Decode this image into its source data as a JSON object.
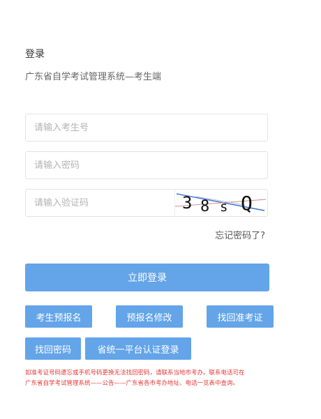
{
  "header": {
    "title": "登录",
    "subtitle": "广东省自学考试管理系统—考生端"
  },
  "form": {
    "exam_number_placeholder": "请输入考生号",
    "password_placeholder": "请输入密码",
    "captcha_placeholder": "请输入验证码",
    "captcha_text": "38sQ",
    "forgot_password": "忘记密码了?",
    "login_button": "立即登录"
  },
  "actions": {
    "pre_register": "考生预报名",
    "modify_pre_register": "预报名修改",
    "retrieve_admission_number": "找回准考证",
    "retrieve_password": "找回密码",
    "unified_platform_login": "省统一平台认证登录"
  },
  "notice": {
    "line1": "如准考证号码遗忘或手机号码更换无法找回密码，请联系当地市考办。联系电话可在",
    "line2": "广东省自学考试管理系统——公告——广东省各市考办地址、电话一览表中查询。"
  },
  "colors": {
    "primary": "#64a4e8",
    "notice": "#e53935"
  }
}
